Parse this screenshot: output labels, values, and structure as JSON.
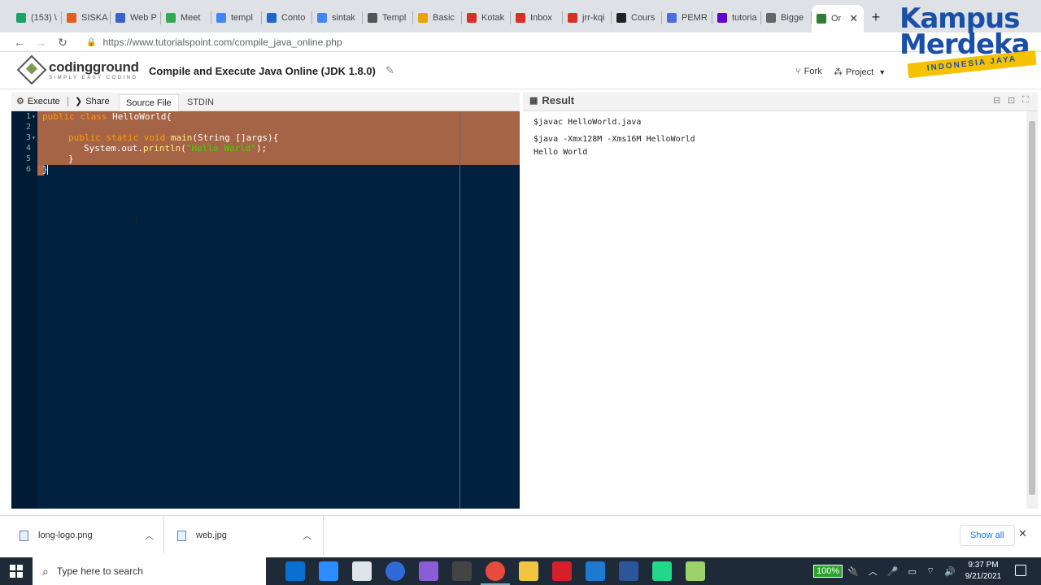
{
  "browser": {
    "tabs": [
      {
        "label": "(153) \\",
        "color": "#1ba261"
      },
      {
        "label": "SISKA",
        "color": "#e55b20"
      },
      {
        "label": "Web P",
        "color": "#3a62c2"
      },
      {
        "label": "Meet",
        "color": "#34a853"
      },
      {
        "label": "templ",
        "color": "#4285f4"
      },
      {
        "label": "Conto",
        "color": "#1f66c9"
      },
      {
        "label": "sintak",
        "color": "#4285f4"
      },
      {
        "label": "Templ",
        "color": "#555555"
      },
      {
        "label": "Basic",
        "color": "#e6a400"
      },
      {
        "label": "Kotak",
        "color": "#d93025"
      },
      {
        "label": "Inbox",
        "color": "#d93025"
      },
      {
        "label": "jrr-kqi",
        "color": "#d93025"
      },
      {
        "label": "Cours",
        "color": "#222222"
      },
      {
        "label": "PEMR",
        "color": "#4a6ee0"
      },
      {
        "label": "tutoria",
        "color": "#6001d2"
      },
      {
        "label": "Bigge",
        "color": "#666666"
      },
      {
        "label": "Or",
        "color": "#2e7d32"
      }
    ],
    "url": "https://www.tutorialspoint.com/compile_java_online.php"
  },
  "site": {
    "logo_main": "codingground",
    "logo_tag": "SIMPLY EASY CODING",
    "title": "Compile and Execute Java Online (JDK 1.8.0)",
    "fork_label": "Fork",
    "project_label": "Project"
  },
  "overlay_logo": {
    "line1": "Kampus",
    "line2": "Merdeka",
    "line3": "INDONESIA JAYA"
  },
  "editor": {
    "execute_label": "Execute",
    "share_label": "Share",
    "tabs": [
      "Source File",
      "STDIN"
    ],
    "line_numbers": [
      "1",
      "2",
      "3",
      "4",
      "5",
      "6"
    ],
    "code": {
      "l1_kw": "public class",
      "l1_rest": " HelloWorld{",
      "l3_kw": "public static void",
      "l3_fn": " main",
      "l3_rest": "(String []args){",
      "l4_a": "System.out.",
      "l4_fn": "println",
      "l4_b": "(",
      "l4_str": "\"Hello World\"",
      "l4_c": ");",
      "l5": "}",
      "l6": "}"
    }
  },
  "result": {
    "title": "Result",
    "lines": [
      "$javac HelloWorld.java",
      "$java -Xmx128M -Xms16M HelloWorld",
      "Hello World"
    ]
  },
  "downloads": {
    "items": [
      "long-logo.png",
      "web.jpg"
    ],
    "show_all": "Show all"
  },
  "taskbar": {
    "search_placeholder": "Type here to search",
    "battery": "100%",
    "time": "9:37 PM",
    "date": "9/21/2021"
  }
}
